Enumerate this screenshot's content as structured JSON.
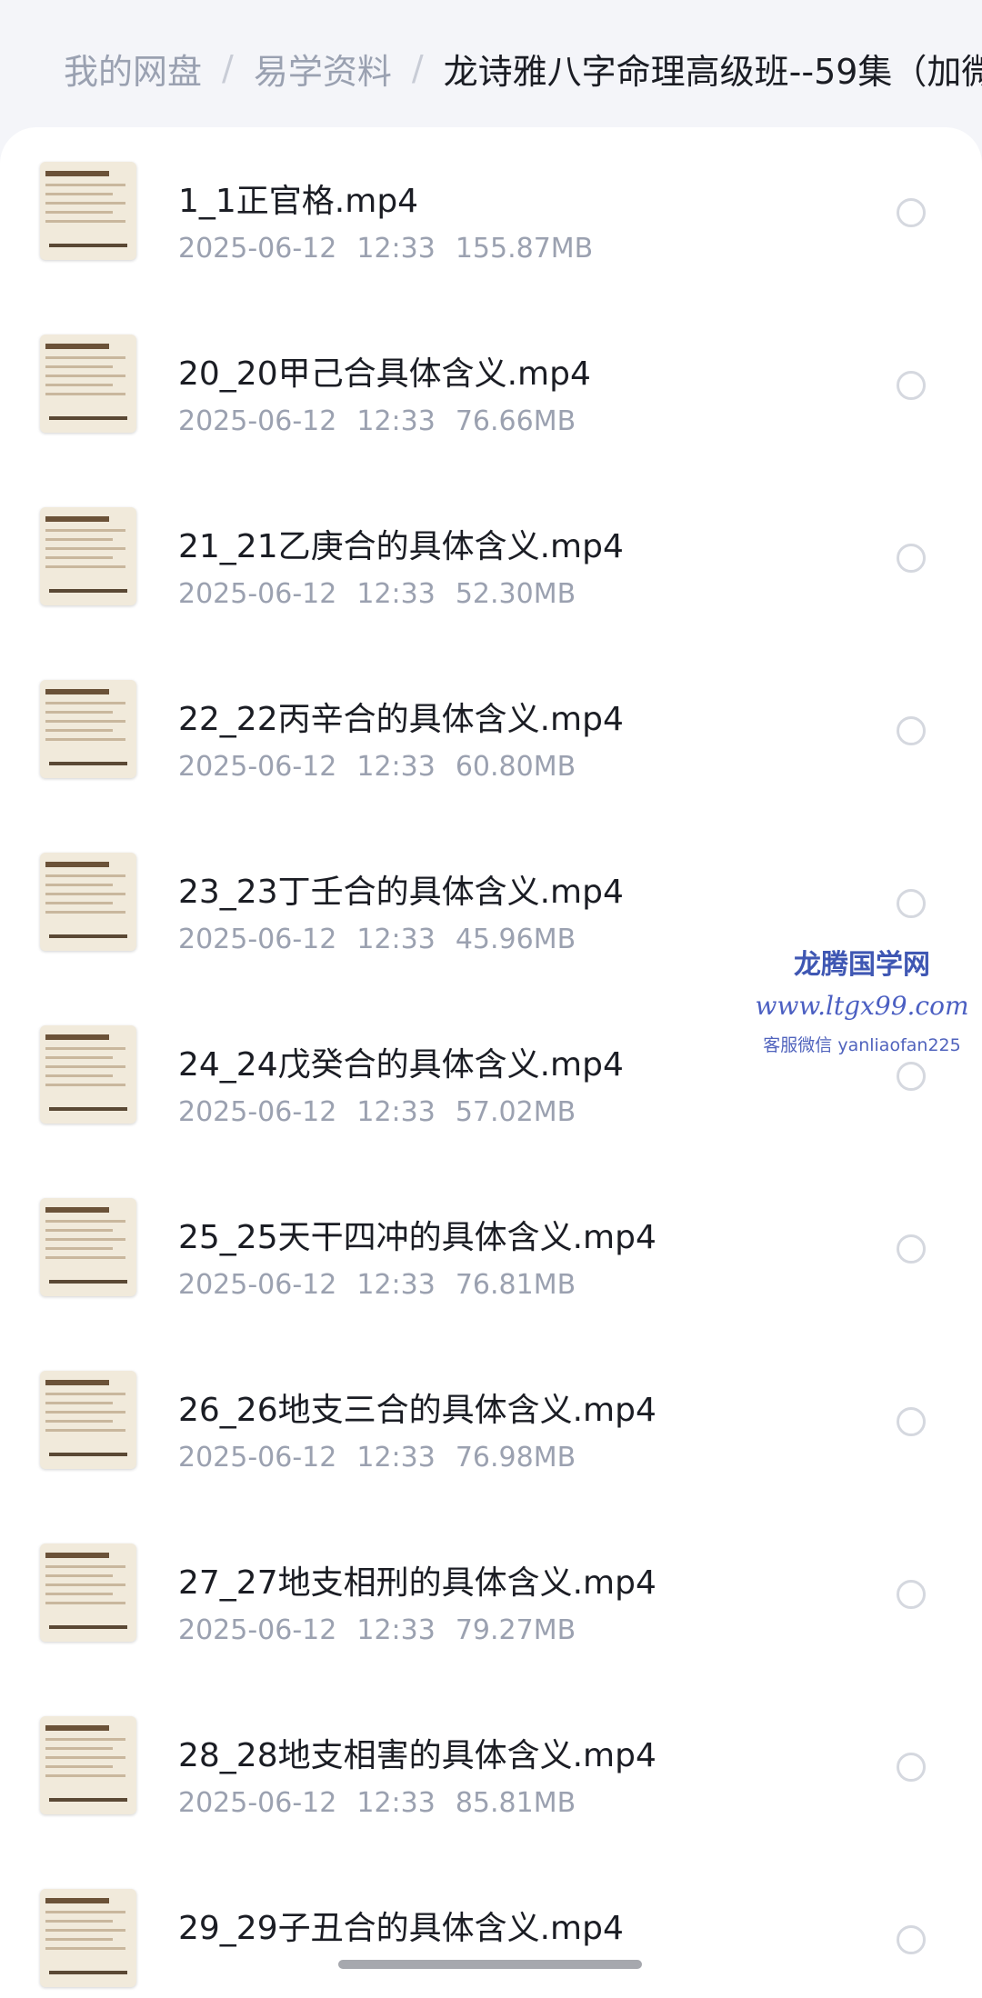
{
  "breadcrumb": {
    "items": [
      "我的网盘",
      "易学资料"
    ],
    "separator": "/",
    "current": "龙诗雅八字命理高级班--59集（加微"
  },
  "files": [
    {
      "name": "1_1正官格.mp4",
      "date": "2025-06-12",
      "time": "12:33",
      "size": "155.87MB",
      "thumb_icon": "video-thumbnail"
    },
    {
      "name": "20_20甲己合具体含义.mp4",
      "date": "2025-06-12",
      "time": "12:33",
      "size": "76.66MB",
      "thumb_icon": "video-thumbnail"
    },
    {
      "name": "21_21乙庚合的具体含义.mp4",
      "date": "2025-06-12",
      "time": "12:33",
      "size": "52.30MB",
      "thumb_icon": "video-thumbnail"
    },
    {
      "name": "22_22丙辛合的具体含义.mp4",
      "date": "2025-06-12",
      "time": "12:33",
      "size": "60.80MB",
      "thumb_icon": "video-thumbnail"
    },
    {
      "name": "23_23丁壬合的具体含义.mp4",
      "date": "2025-06-12",
      "time": "12:33",
      "size": "45.96MB",
      "thumb_icon": "video-thumbnail"
    },
    {
      "name": "24_24戊癸合的具体含义.mp4",
      "date": "2025-06-12",
      "time": "12:33",
      "size": "57.02MB",
      "thumb_icon": "video-thumbnail"
    },
    {
      "name": "25_25天干四冲的具体含义.mp4",
      "date": "2025-06-12",
      "time": "12:33",
      "size": "76.81MB",
      "thumb_icon": "video-thumbnail"
    },
    {
      "name": "26_26地支三合的具体含义.mp4",
      "date": "2025-06-12",
      "time": "12:33",
      "size": "76.98MB",
      "thumb_icon": "video-thumbnail"
    },
    {
      "name": "27_27地支相刑的具体含义.mp4",
      "date": "2025-06-12",
      "time": "12:33",
      "size": "79.27MB",
      "thumb_icon": "video-thumbnail"
    },
    {
      "name": "28_28地支相害的具体含义.mp4",
      "date": "2025-06-12",
      "time": "12:33",
      "size": "85.81MB",
      "thumb_icon": "video-thumbnail"
    },
    {
      "name": "29_29子丑合的具体含义.mp4",
      "date": "",
      "time": "",
      "size": "",
      "thumb_icon": "video-thumbnail"
    }
  ],
  "watermark": {
    "title": "龙腾国学网",
    "url": "www.ltgx99.com",
    "contact": "客服微信 yanliaofan225"
  },
  "colors": {
    "background": "#f4f5f9",
    "card": "#ffffff",
    "text_primary": "#1b1d24",
    "text_secondary": "#9ba1b0",
    "watermark": "#4b5fc2"
  }
}
